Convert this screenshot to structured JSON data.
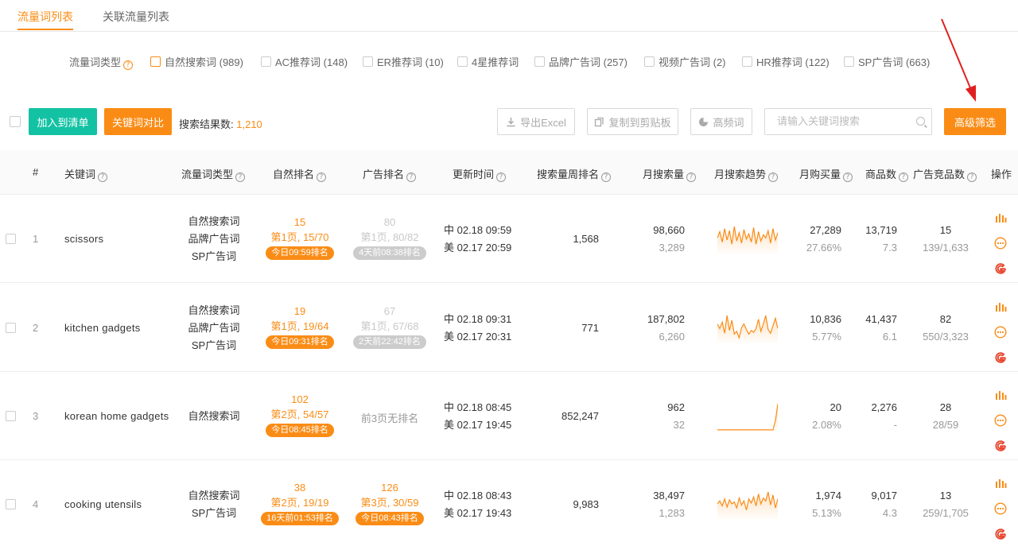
{
  "tabs": [
    "流量词列表",
    "关联流量列表"
  ],
  "filter": {
    "label": "流量词类型",
    "options": [
      "自然搜索词 (989)",
      "AC推荐词 (148)",
      "ER推荐词 (10)",
      "4星推荐词",
      "品牌广告词 (257)",
      "视频广告词 (2)",
      "HR推荐词 (122)",
      "SP广告词 (663)"
    ]
  },
  "toolbar": {
    "add_list": "加入到清单",
    "compare": "关键词对比",
    "result_label": "搜索结果数:",
    "result_count": "1,210",
    "export": "导出Excel",
    "copy": "复制到剪贴板",
    "high_freq": "高频词",
    "search_placeholder": "请输入关键词搜索",
    "advanced": "高级筛选"
  },
  "columns": [
    "#",
    "关键词",
    "流量词类型",
    "自然排名",
    "广告排名",
    "更新时间",
    "搜索量周排名",
    "月搜索量",
    "月搜索趋势",
    "月购买量",
    "商品数",
    "广告竞品数",
    "操作"
  ],
  "rows": [
    {
      "index": "1",
      "keyword": "scissors",
      "types": [
        "自然搜索词",
        "品牌广告词",
        "SP广告词"
      ],
      "natural": {
        "rank": "15",
        "page": "第1页, 15/70",
        "badge": "今日09:59排名"
      },
      "ad": {
        "rank": "80",
        "page": "第1页, 80/82",
        "badge": "4天前08:38排名"
      },
      "cn_time": "中 02.18 09:59",
      "us_time": "美 02.17 20:59",
      "weekly_rank": "1,568",
      "monthly_search": "98,660",
      "daily_search": "3,289",
      "trend": [
        30,
        42,
        22,
        48,
        26,
        44,
        18,
        52,
        24,
        40,
        20,
        46,
        28,
        38,
        22,
        50,
        18,
        42,
        24,
        36,
        30,
        44,
        20,
        48,
        26,
        40
      ],
      "monthly_buy": "27,289",
      "buy_rate": "27.66%",
      "products": "13,719",
      "products_sub": "7.3",
      "ad_comp": "15",
      "ad_comp_sub": "139/1,633"
    },
    {
      "index": "2",
      "keyword": "kitchen gadgets",
      "types": [
        "自然搜索词",
        "品牌广告词",
        "SP广告词"
      ],
      "natural": {
        "rank": "19",
        "page": "第1页, 19/64",
        "badge": "今日09:31排名"
      },
      "ad": {
        "rank": "67",
        "page": "第1页, 67/68",
        "badge": "2天前22:42排名"
      },
      "cn_time": "中 02.18 09:31",
      "us_time": "美 02.17 20:31",
      "weekly_rank": "771",
      "monthly_search": "187,802",
      "daily_search": "6,260",
      "trend": [
        40,
        30,
        44,
        20,
        58,
        26,
        48,
        18,
        24,
        10,
        32,
        40,
        28,
        18,
        26,
        22,
        30,
        50,
        24,
        40,
        58,
        28,
        20,
        36,
        52,
        30
      ],
      "monthly_buy": "10,836",
      "buy_rate": "5.77%",
      "products": "41,437",
      "products_sub": "6.1",
      "ad_comp": "82",
      "ad_comp_sub": "550/3,323"
    },
    {
      "index": "3",
      "keyword": "korean home gadgets",
      "types": [
        "自然搜索词"
      ],
      "natural": {
        "rank": "102",
        "page": "第2页, 54/57",
        "badge": "今日08:45排名"
      },
      "ad": {
        "none": "前3页无排名"
      },
      "cn_time": "中 02.18 08:45",
      "us_time": "美 02.17 19:45",
      "weekly_rank": "852,247",
      "monthly_search": "962",
      "daily_search": "32",
      "trend": [
        2,
        2,
        2,
        2,
        2,
        2,
        2,
        2,
        2,
        2,
        2,
        2,
        2,
        2,
        2,
        2,
        2,
        2,
        2,
        2,
        2,
        2,
        2,
        2,
        22,
        60
      ],
      "monthly_buy": "20",
      "buy_rate": "2.08%",
      "products": "2,276",
      "products_sub": "-",
      "ad_comp": "28",
      "ad_comp_sub": "28/59"
    },
    {
      "index": "4",
      "keyword": "cooking utensils",
      "types": [
        "自然搜索词",
        "SP广告词"
      ],
      "natural": {
        "rank": "38",
        "page": "第2页, 19/19",
        "badge": "16天前01:53排名"
      },
      "ad": {
        "rank": "126",
        "page": "第3页, 30/59",
        "badge": "今日08:43排名"
      },
      "cn_time": "中 02.18 08:43",
      "us_time": "美 02.17 19:43",
      "weekly_rank": "9,983",
      "monthly_search": "38,497",
      "daily_search": "1,283",
      "trend": [
        30,
        36,
        26,
        40,
        24,
        38,
        30,
        34,
        22,
        42,
        28,
        36,
        18,
        40,
        32,
        44,
        26,
        50,
        30,
        42,
        36,
        54,
        28,
        48,
        22,
        40
      ],
      "monthly_buy": "1,974",
      "buy_rate": "5.13%",
      "products": "9,017",
      "products_sub": "4.3",
      "ad_comp": "13",
      "ad_comp_sub": "259/1,705"
    }
  ],
  "colors": {
    "accent": "#fa8c16",
    "teal": "#13c2a3",
    "google_red": "#e8472f",
    "arrow": "#e02020"
  }
}
